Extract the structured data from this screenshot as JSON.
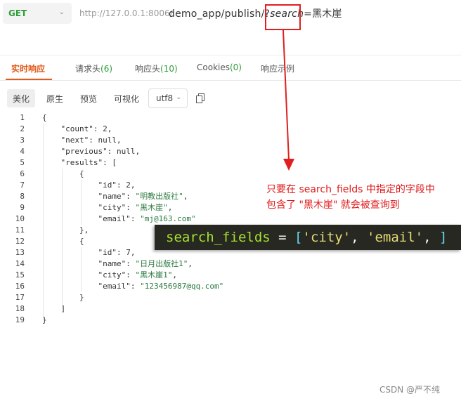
{
  "request": {
    "method": "GET",
    "host": "http://127.0.0.1:8006/",
    "path_prefix": "demo_app/publish/?",
    "param_name": "search",
    "param_rest": "=黑木崖"
  },
  "tabs": [
    {
      "label": "实时响应",
      "count": ""
    },
    {
      "label": "请求头",
      "count": "(6)"
    },
    {
      "label": "响应头",
      "count": "(10)"
    },
    {
      "label": "Cookies",
      "count": "(0)"
    },
    {
      "label": "响应示例",
      "count": ""
    }
  ],
  "toolbar": {
    "buttons": [
      "美化",
      "原生",
      "预览",
      "可视化"
    ],
    "encoding": "utf8"
  },
  "icons": {
    "method_dropdown": "chevron-down-icon",
    "encoding_dropdown": "chevron-down-icon",
    "copy": "copy-icon"
  },
  "code_lines": [
    "{",
    "    \"count\": 2,",
    "    \"next\": null,",
    "    \"previous\": null,",
    "    \"results\": [",
    "        {",
    "            \"id\": 2,",
    "            \"name\": \"明教出版社\",",
    "            \"city\": \"黑木崖\",",
    "            \"email\": \"mj@163.com\"",
    "        },",
    "        {",
    "            \"id\": 7,",
    "            \"name\": \"日月出版社1\",",
    "            \"city\": \"黑木崖1\",",
    "            \"email\": \"123456987@qq.com\"",
    "        }",
    "    ]",
    "}"
  ],
  "overlay": {
    "var": "search_fields",
    "op": " = ",
    "open": "[",
    "s1": "'city'",
    "comma1": ", ",
    "s2": "'email'",
    "comma2": ", ",
    "close": "]"
  },
  "annotation": {
    "line1": "只要在 search_fields 中指定的字段中",
    "line2": "包含了 \"黑木崖\" 就会被查询到"
  },
  "watermark": "CSDN @严不纯",
  "colors": {
    "accent": "#e25a1c",
    "method": "#2e9d3a",
    "annotation": "#e01a1a"
  }
}
